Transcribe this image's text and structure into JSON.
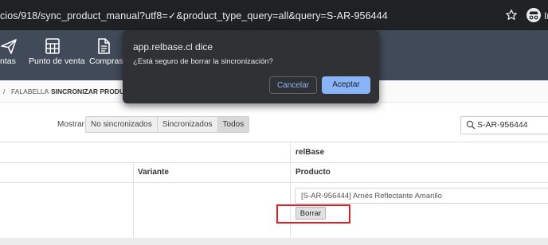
{
  "browser": {
    "url": "cios/918/sync_product_manual?utf8=✓&product_type_query=all&query=S-AR-956444",
    "profile_label": "In"
  },
  "nav": {
    "items": [
      {
        "label": "ntas",
        "icon": "send-icon"
      },
      {
        "label": "Punto de venta",
        "icon": "calculator-icon"
      },
      {
        "label": "Compras",
        "icon": "document-icon"
      }
    ]
  },
  "breadcrumb": {
    "sep1": "/",
    "item": "FALABELLA",
    "sep2": "/",
    "current": "SINCRONIZAR PRODUCTOS"
  },
  "filter": {
    "label": "Mostrar:",
    "options": [
      "No sincronizados",
      "Sincronizados",
      "Todos"
    ],
    "selected": "Todos"
  },
  "search": {
    "value": "S-AR-956444"
  },
  "table": {
    "group_header": "relBase",
    "columns": [
      "Variante",
      "Producto"
    ],
    "row": {
      "product": "[S-AR-956444] Arnés Reflectante Amarillo",
      "delete_label": "Borrar"
    }
  },
  "dialog": {
    "title": "app.relbase.cl dice",
    "message": "¿Está seguro de borrar la sincronización?",
    "cancel_label": "Cancelar",
    "ok_label": "Aceptar"
  },
  "colors": {
    "navbar": "#414a58",
    "dialog_bg": "#303134",
    "primary_button": "#8ab4f8",
    "highlight": "#e02020"
  }
}
